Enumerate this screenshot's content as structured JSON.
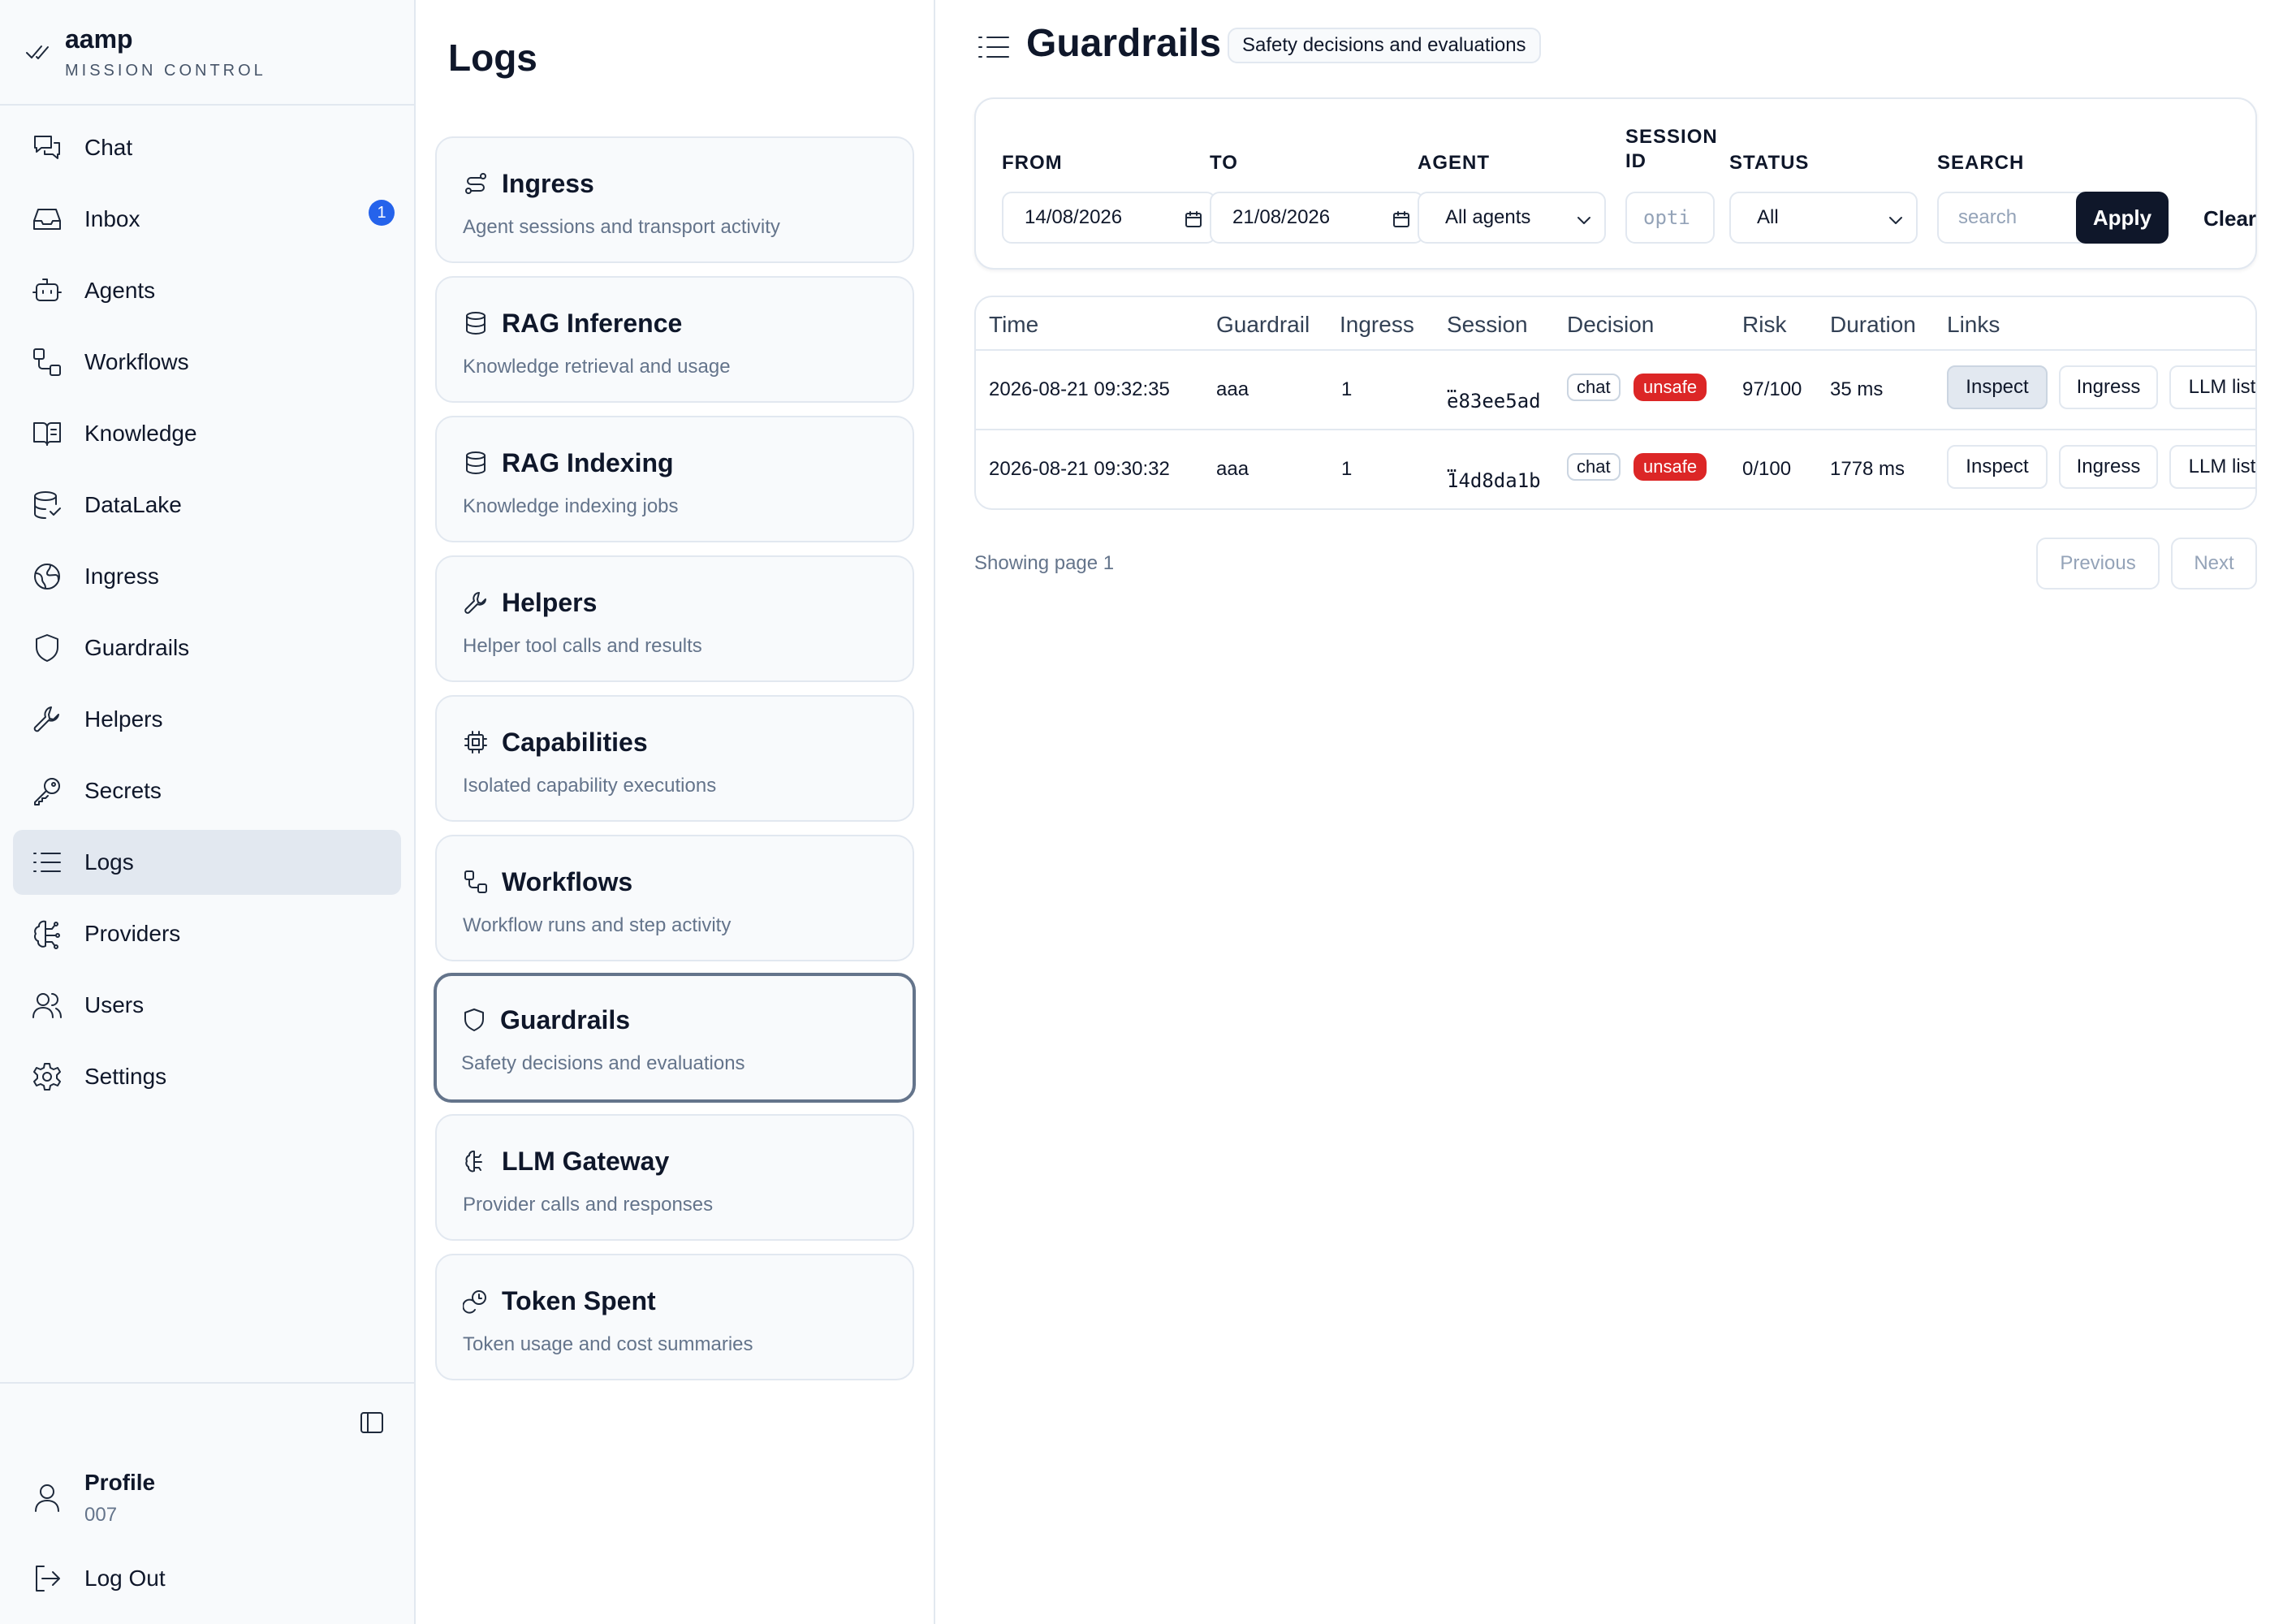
{
  "brand": {
    "name": "aamp",
    "subtitle": "MISSION CONTROL"
  },
  "sidebar": {
    "items": [
      {
        "label": "Chat",
        "icon": "chat-icon"
      },
      {
        "label": "Inbox",
        "icon": "inbox-icon",
        "badge": "1"
      },
      {
        "label": "Agents",
        "icon": "robot-icon"
      },
      {
        "label": "Workflows",
        "icon": "workflow-icon"
      },
      {
        "label": "Knowledge",
        "icon": "book-icon"
      },
      {
        "label": "DataLake",
        "icon": "database-icon"
      },
      {
        "label": "Ingress",
        "icon": "globe-icon"
      },
      {
        "label": "Guardrails",
        "icon": "shield-icon"
      },
      {
        "label": "Helpers",
        "icon": "wrench-icon"
      },
      {
        "label": "Secrets",
        "icon": "key-icon"
      },
      {
        "label": "Logs",
        "icon": "list-icon",
        "active": true
      },
      {
        "label": "Providers",
        "icon": "brain-icon"
      },
      {
        "label": "Users",
        "icon": "users-icon"
      },
      {
        "label": "Settings",
        "icon": "gear-icon"
      }
    ],
    "profile": {
      "label": "Profile",
      "id": "007"
    },
    "logout": "Log Out"
  },
  "logs": {
    "title": "Logs",
    "cards": [
      {
        "title": "Ingress",
        "desc": "Agent sessions and transport activity",
        "icon": "route-icon"
      },
      {
        "title": "RAG Inference",
        "desc": "Knowledge retrieval and usage",
        "icon": "database-icon"
      },
      {
        "title": "RAG Indexing",
        "desc": "Knowledge indexing jobs",
        "icon": "database-icon"
      },
      {
        "title": "Helpers",
        "desc": "Helper tool calls and results",
        "icon": "wrench-icon"
      },
      {
        "title": "Capabilities",
        "desc": "Isolated capability executions",
        "icon": "chip-icon"
      },
      {
        "title": "Workflows",
        "desc": "Workflow runs and step activity",
        "icon": "workflow-icon"
      },
      {
        "title": "Guardrails",
        "desc": "Safety decisions and evaluations",
        "icon": "shield-icon",
        "active": true
      },
      {
        "title": "LLM Gateway",
        "desc": "Provider calls and responses",
        "icon": "brain-icon"
      },
      {
        "title": "Token Spent",
        "desc": "Token usage and cost summaries",
        "icon": "coins-icon"
      }
    ]
  },
  "main": {
    "title": "Guardrails",
    "badge": "Safety decisions and evaluations",
    "filters": {
      "from_label": "FROM",
      "from_value": "14/08/2026",
      "to_label": "TO",
      "to_value": "21/08/2026",
      "agent_label": "AGENT",
      "agent_value": "All agents",
      "session_label_1": "SESSION",
      "session_label_2": "ID",
      "session_placeholder": "opti",
      "status_label": "STATUS",
      "status_value": "All",
      "search_label": "SEARCH",
      "search_placeholder": "search",
      "apply": "Apply",
      "clear": "Clear"
    },
    "table": {
      "headers": [
        "Time",
        "Guardrail",
        "Ingress",
        "Session",
        "Decision",
        "Risk",
        "Duration",
        "Links"
      ],
      "rows": [
        {
          "time": "2026-08-21 09:32:35",
          "guardrail": "aaa",
          "ingress": "1",
          "session_dots": "…",
          "session": "e83ee5ad",
          "type": "chat",
          "decision": "unsafe",
          "risk": "97/100",
          "duration": "35 ms",
          "inspect": "Inspect",
          "ingress_link": "Ingress",
          "llm": "LLM list"
        },
        {
          "time": "2026-08-21 09:30:32",
          "guardrail": "aaa",
          "ingress": "1",
          "session_dots": "…",
          "session": "14d8da1b",
          "type": "chat",
          "decision": "unsafe",
          "risk": "0/100",
          "duration": "1778 ms",
          "inspect": "Inspect",
          "ingress_link": "Ingress",
          "llm": "LLM list"
        }
      ]
    },
    "pagination": {
      "showing": "Showing page 1",
      "previous": "Previous",
      "next": "Next"
    }
  },
  "colors": {
    "accent": "#0f172a",
    "danger": "#dc2626",
    "badge": "#2563eb",
    "active_bg": "#e2e8f0"
  }
}
